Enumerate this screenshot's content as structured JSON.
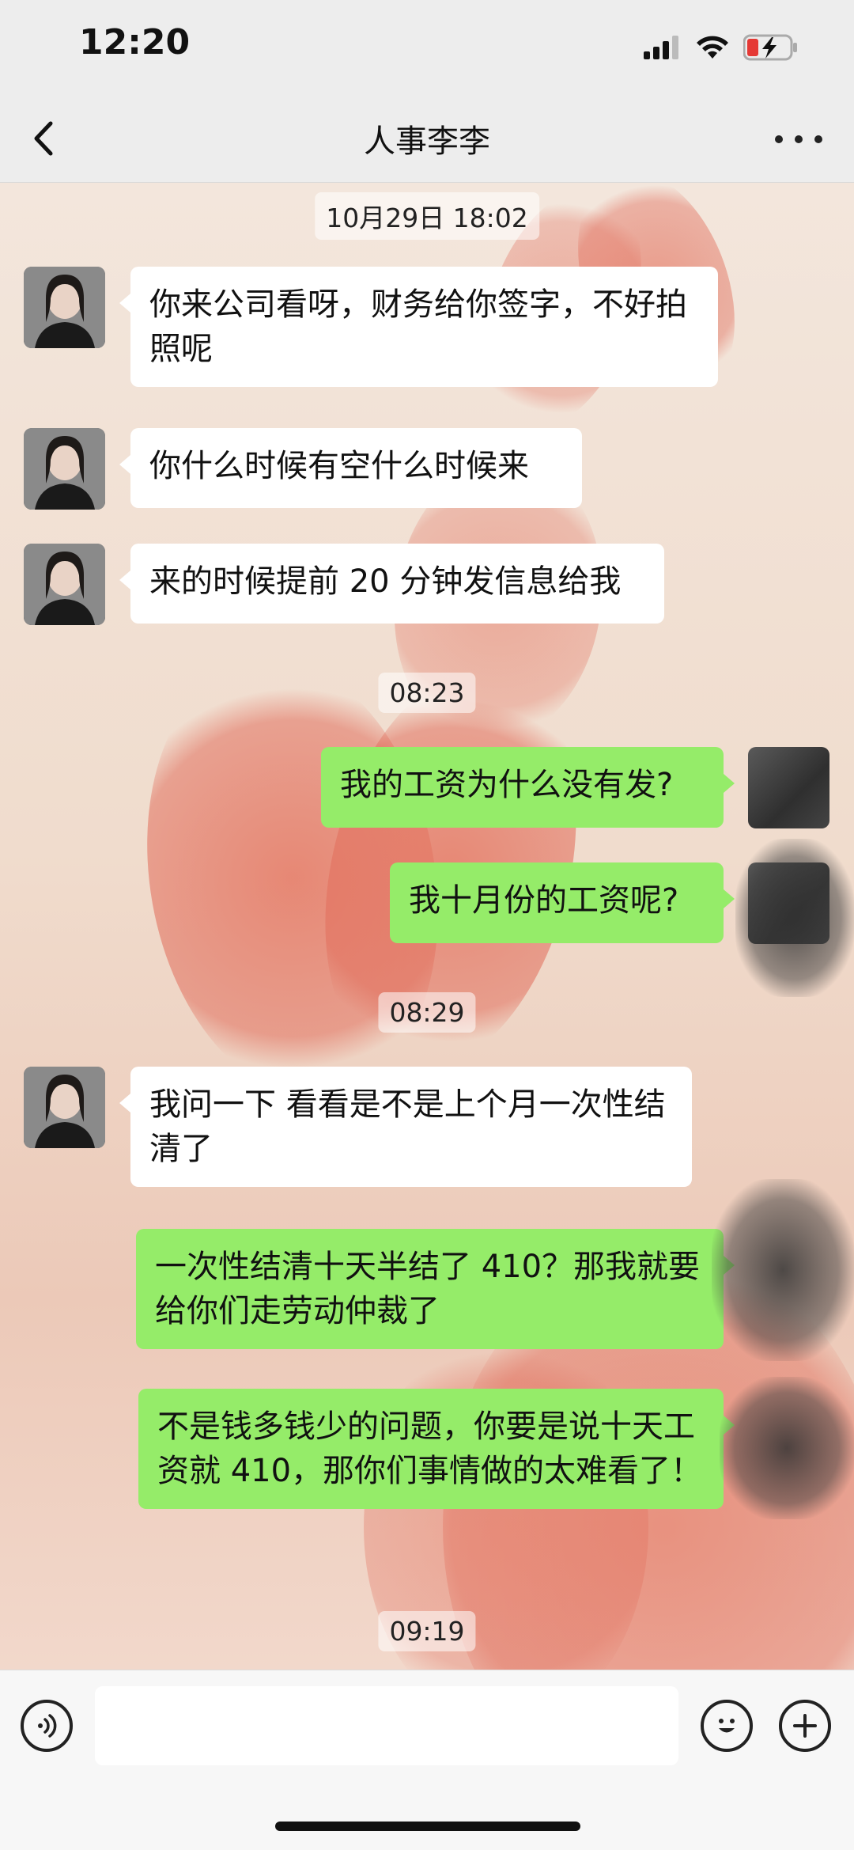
{
  "status_bar": {
    "time": "12:20"
  },
  "header": {
    "title": "人事李李"
  },
  "messages": [
    {
      "type": "timestamp",
      "text": "10月29日 18:02"
    },
    {
      "type": "in",
      "text": "你来公司看呀，财务给你签字，不好拍照呢"
    },
    {
      "type": "in",
      "text": "你什么时候有空什么时候来"
    },
    {
      "type": "in",
      "text": "来的时候提前 20 分钟发信息给我"
    },
    {
      "type": "timestamp",
      "text": "08:23"
    },
    {
      "type": "out",
      "text": "我的工资为什么没有发?"
    },
    {
      "type": "out",
      "text": "我十月份的工资呢?"
    },
    {
      "type": "timestamp",
      "text": "08:29"
    },
    {
      "type": "in",
      "text": "我问一下 看看是不是上个月一次性结清了"
    },
    {
      "type": "out",
      "text": "一次性结清十天半结了 410？那我就要给你们走劳动仲裁了"
    },
    {
      "type": "out",
      "text": "不是钱多钱少的问题，你要是说十天工资就 410，那你们事情做的太难看了！"
    },
    {
      "type": "timestamp",
      "text": "09:19"
    }
  ],
  "input_bar": {
    "placeholder": ""
  },
  "icons": {
    "back": "chevron-left-icon",
    "more": "more-dots-icon",
    "voice": "voice-icon",
    "emoji": "emoji-icon",
    "plus": "plus-icon",
    "signal": "signal-icon",
    "wifi": "wifi-icon",
    "battery": "battery-charging-icon"
  },
  "colors": {
    "outgoing_bubble": "#95ec69",
    "incoming_bubble": "#ffffff",
    "battery_low": "#e53935"
  }
}
